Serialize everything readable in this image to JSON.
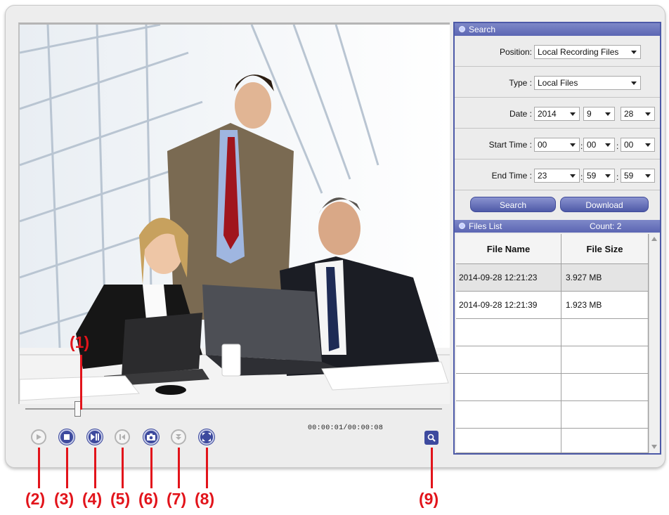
{
  "search": {
    "title": "Search",
    "position_label": "Position:",
    "position_value": "Local Recording Files",
    "type_label": "Type :",
    "type_value": "Local Files",
    "date_label": "Date :",
    "date_year": "2014",
    "date_month": "9",
    "date_day": "28",
    "start_label": "Start Time :",
    "start_h": "00",
    "start_m": "00",
    "start_s": "00",
    "end_label": "End Time :",
    "end_h": "23",
    "end_m": "59",
    "end_s": "59",
    "colon": ":",
    "search_button": "Search",
    "download_button": "Download"
  },
  "files": {
    "title": "Files List",
    "count": "Count: 2",
    "col_name": "File Name",
    "col_size": "File Size",
    "rows": [
      {
        "name": "2014-09-28 12:21:23",
        "size": "3.927 MB"
      },
      {
        "name": "2014-09-28 12:21:39",
        "size": "1.923 MB"
      }
    ]
  },
  "player": {
    "timecode": "00:00:01/00:00:08",
    "progress_fraction": 0.125
  },
  "controls": [
    {
      "name": "play-icon",
      "enabled": false
    },
    {
      "name": "stop-icon",
      "enabled": true
    },
    {
      "name": "pause-step-icon",
      "enabled": true
    },
    {
      "name": "previous-frame-icon",
      "enabled": false
    },
    {
      "name": "snapshot-icon",
      "enabled": true
    },
    {
      "name": "download-icon",
      "enabled": false
    },
    {
      "name": "fullscreen-icon",
      "enabled": true
    },
    {
      "name": "zoom-icon",
      "enabled": true
    }
  ],
  "callouts": {
    "c1": "(1)",
    "c2": "(2)",
    "c3": "(3)",
    "c4": "(4)",
    "c5": "(5)",
    "c6": "(6)",
    "c7": "(7)",
    "c8": "(8)",
    "c9": "(9)"
  },
  "colors": {
    "accent": "#4d5aa8",
    "callout_red": "#e2141b"
  }
}
